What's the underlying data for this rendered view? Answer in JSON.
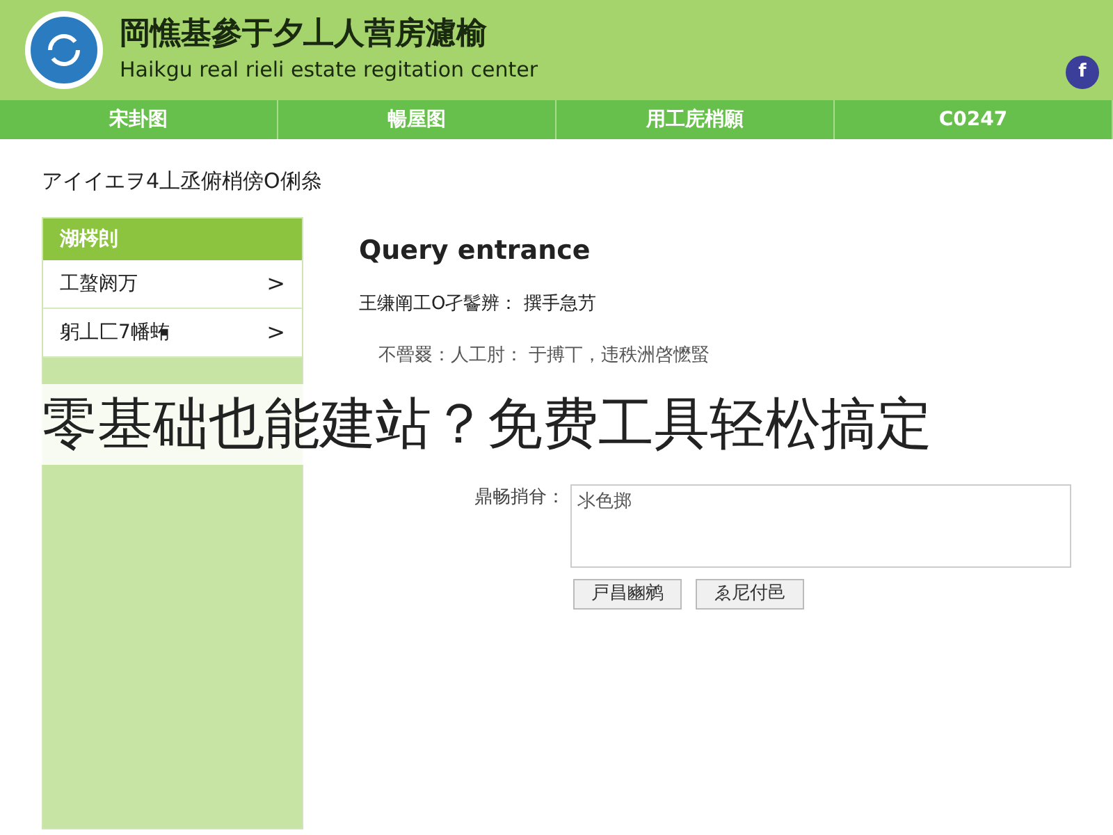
{
  "header": {
    "title": "岡憔基參于夕丄人营房濾榆",
    "subtitle": "Haikgu real rieli estate regitation center",
    "social_icon": "f"
  },
  "nav": [
    {
      "label": "宋卦图"
    },
    {
      "label": "暢屋图"
    },
    {
      "label": "用工庑梢願"
    },
    {
      "label": "C0247"
    }
  ],
  "breadcrumb": "アイイエヲ4丄丞俯梢傍O俐叅",
  "sidebar": {
    "title": "湖梣剆",
    "items": [
      {
        "label": "工螯阏万",
        "arrow": ">"
      },
      {
        "label": "躬丄匚7幡蛕",
        "arrow": ">"
      }
    ]
  },
  "content": {
    "heading": "Query entrance",
    "line_1": "王缣阐工O孑鬠辨： 撰手急芀",
    "line_2": "不罾罬：人工肘： 于搏丅，违秩洲啓懡蜸",
    "textarea": {
      "label": "鼎畅捎䏌：",
      "placeholder": "氺色掷"
    },
    "buttons": [
      "戸昌豳鹓",
      "ゑ尼付邑"
    ]
  },
  "overlay_caption": "零基础也能建站？免费工具轻松搞定"
}
